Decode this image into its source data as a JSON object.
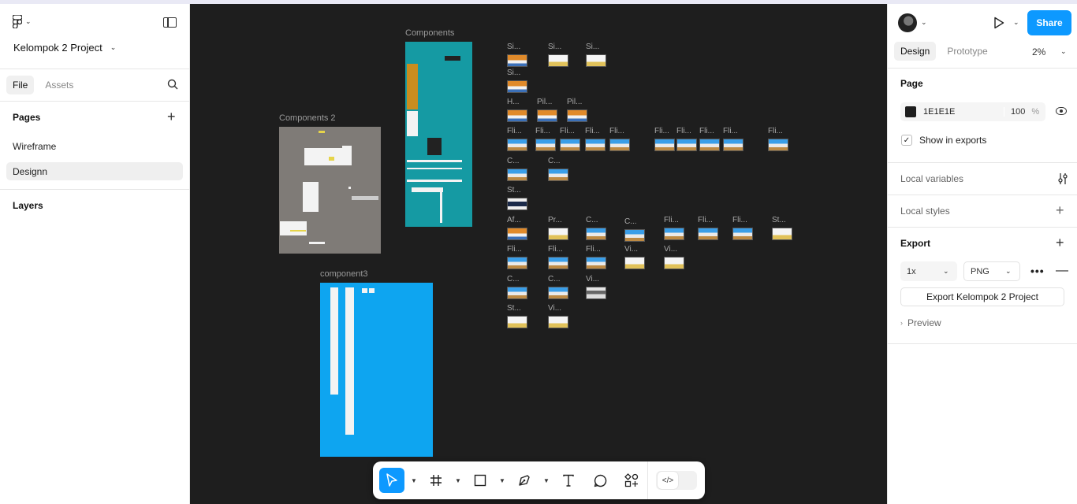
{
  "app": {
    "project_name": "Kelompok 2 Project"
  },
  "left_panel": {
    "tabs": [
      {
        "label": "File"
      },
      {
        "label": "Assets"
      }
    ],
    "pages_title": "Pages",
    "pages": [
      {
        "label": "Wireframe"
      },
      {
        "label": "Designn"
      }
    ],
    "layers_title": "Layers"
  },
  "canvas": {
    "frames": [
      {
        "label": "Components 2"
      },
      {
        "label": "Components"
      },
      {
        "label": "component3"
      }
    ],
    "thumbs": [
      "Si...",
      "Si...",
      "Si...",
      "Si...",
      "H...",
      "Pil...",
      "Pil...",
      "Fli...",
      "Fli...",
      "Fli...",
      "Fli...",
      "Fli...",
      "Fli...",
      "Fli...",
      "Fli...",
      "Fli...",
      "Fli...",
      "C...",
      "C...",
      "St...",
      "Af...",
      "Pr...",
      "C...",
      "C...",
      "Fli...",
      "Fli...",
      "Fli...",
      "St...",
      "Fli...",
      "Fli...",
      "Fli...",
      "Vi...",
      "Vi...",
      "C...",
      "C...",
      "Vi...",
      "St...",
      "Vi..."
    ]
  },
  "toolbar": {
    "tools": [
      "move-tool",
      "frame-tool",
      "shape-tool",
      "pen-tool",
      "text-tool",
      "comment-tool",
      "actions-tool",
      "dev-mode-toggle"
    ]
  },
  "right_panel": {
    "share_label": "Share",
    "tabs": [
      {
        "label": "Design"
      },
      {
        "label": "Prototype"
      }
    ],
    "zoom": "2%",
    "page_title": "Page",
    "bg_color_hex": "1E1E1E",
    "bg_color": "#1e1e1e",
    "bg_opacity": "100",
    "bg_opacity_unit": "%",
    "show_in_exports_label": "Show in exports",
    "show_in_exports": true,
    "local_variables": "Local variables",
    "local_styles": "Local styles",
    "export_title": "Export",
    "export_scale": "1x",
    "export_format": "PNG",
    "export_button": "Export Kelompok 2 Project",
    "preview_label": "Preview"
  },
  "help_label": "?",
  "colors": {
    "accent": "#0d99ff",
    "canvas": "#1e1e1e",
    "teal_frame": "#159aa3",
    "blue_frame": "#0ea5f0",
    "gray_frame": "#7f7b77"
  }
}
